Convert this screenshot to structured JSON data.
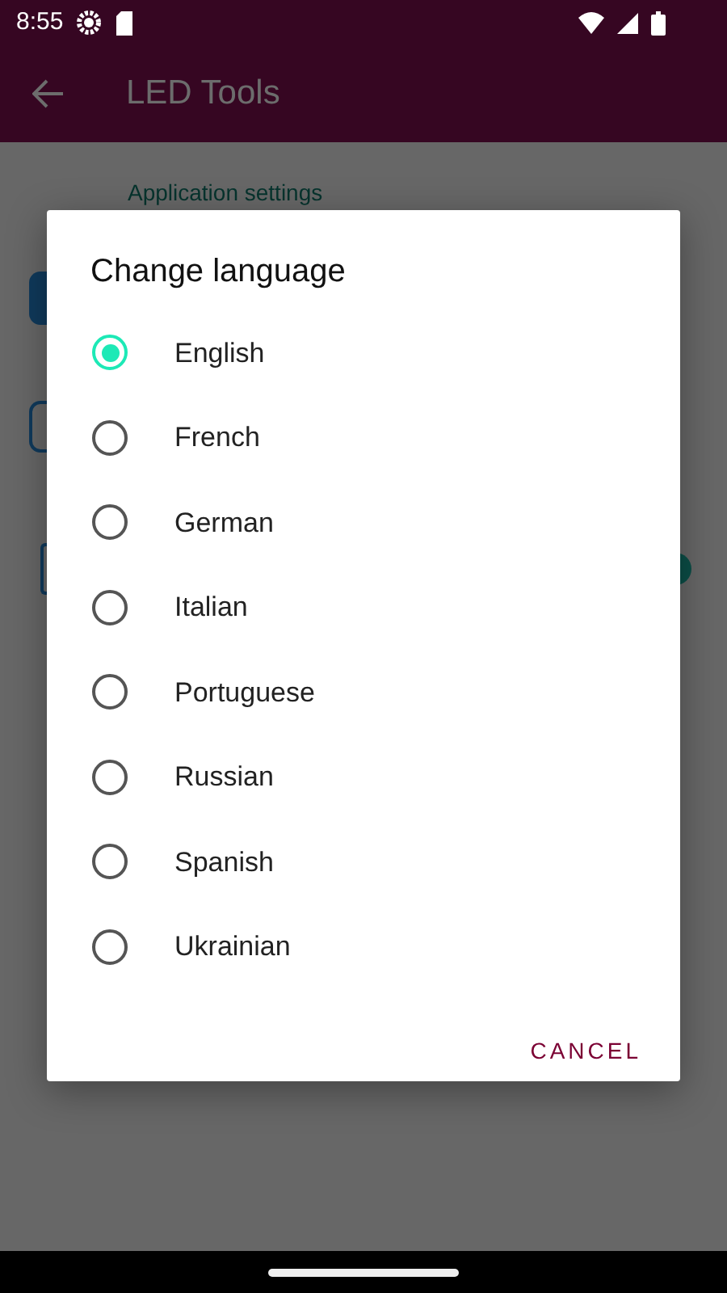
{
  "status_bar": {
    "time": "8:55"
  },
  "app_bar": {
    "title": "LED Tools"
  },
  "settings": {
    "section_title": "Application settings"
  },
  "dialog": {
    "title": "Change language",
    "options": [
      {
        "label": "English",
        "selected": true
      },
      {
        "label": "French",
        "selected": false
      },
      {
        "label": "German",
        "selected": false
      },
      {
        "label": "Italian",
        "selected": false
      },
      {
        "label": "Portuguese",
        "selected": false
      },
      {
        "label": "Russian",
        "selected": false
      },
      {
        "label": "Spanish",
        "selected": false
      },
      {
        "label": "Ukrainian",
        "selected": false
      }
    ],
    "buttons": [
      "CANCEL"
    ]
  }
}
